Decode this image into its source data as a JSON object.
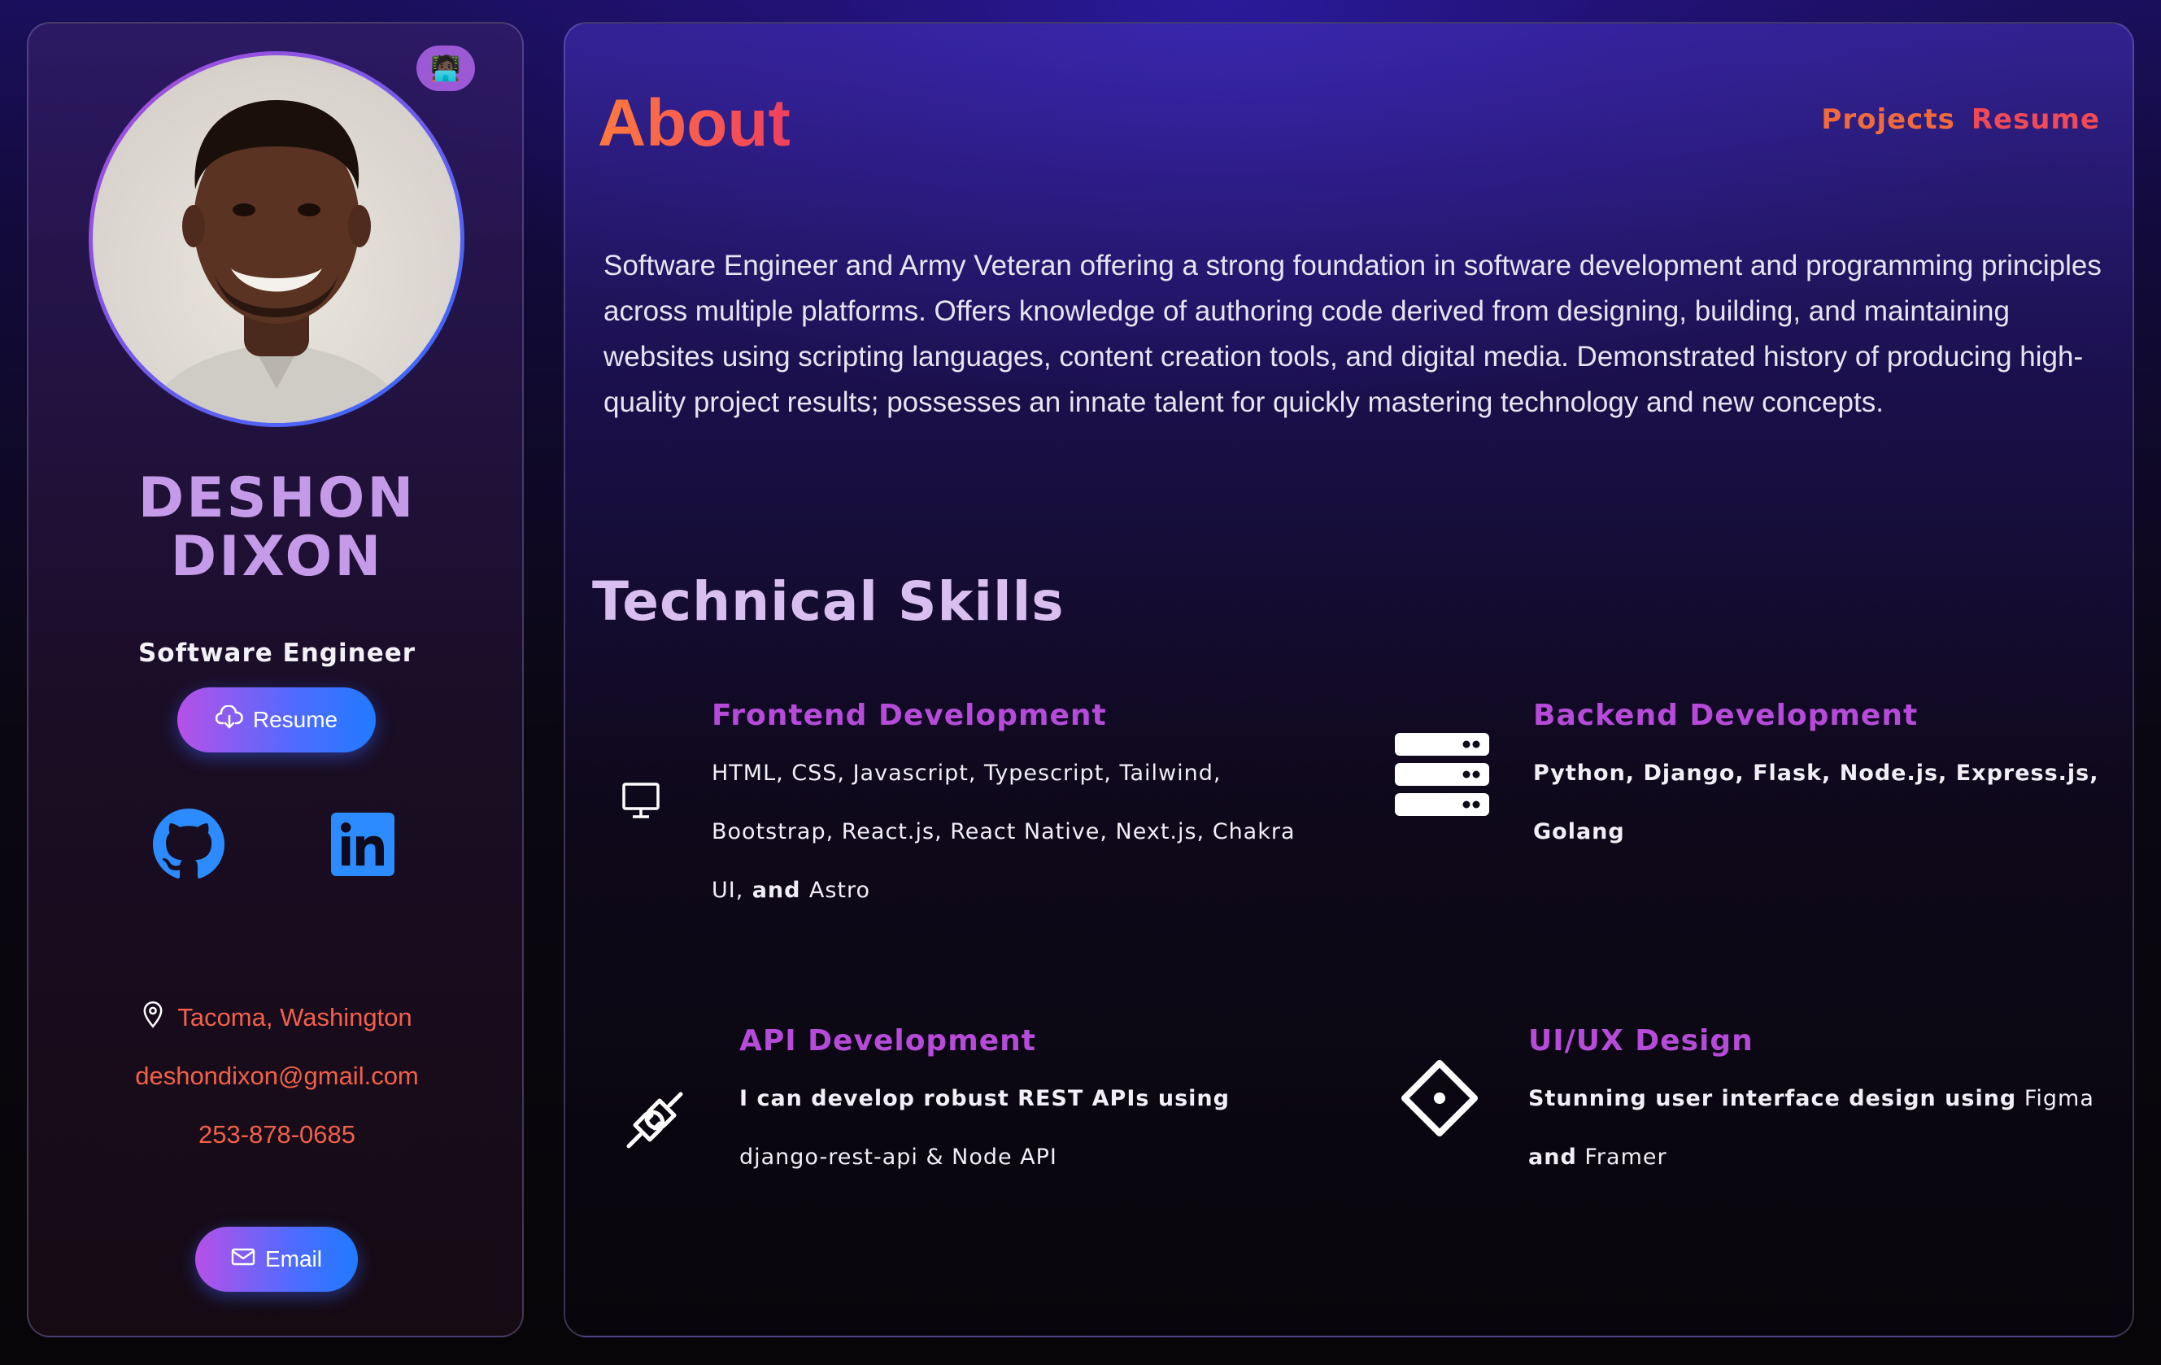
{
  "profile": {
    "name_line1": "DESHON",
    "name_line2": "DIXON",
    "role": "Software Engineer",
    "badge_emoji": "🧑🏿‍💻",
    "resume_label": "Resume",
    "email_button_label": "Email",
    "location": "Tacoma, Washington",
    "email": "deshondixon@gmail.com",
    "phone": "253-878-0685"
  },
  "social": {
    "github_icon": "github-icon",
    "linkedin_icon": "linkedin-icon"
  },
  "header": {
    "title": "About",
    "nav": [
      "Projects",
      "Resume"
    ]
  },
  "about": {
    "text": "Software Engineer and Army Veteran offering a strong foundation in software development and programming principles across multiple platforms. Offers knowledge of authoring code derived from designing, building, and maintaining websites using scripting languages, content creation tools, and digital media. Demonstrated history of producing high-quality project results; possesses an innate talent for quickly mastering technology and new concepts."
  },
  "skills": {
    "title": "Technical Skills",
    "frontend": {
      "title": "Frontend Development",
      "text_a": "HTML, CSS, Javascript, Typescript, Tailwind, Bootstrap, React.js, React Native, Next.js, Chakra UI,",
      "text_b": " and ",
      "text_c": "Astro",
      "icon": "monitor-icon"
    },
    "backend": {
      "title": "Backend Development",
      "text": "Python, Django, Flask, Node.js, Express.js, Golang",
      "icon": "server-icon"
    },
    "api": {
      "title": "API Development",
      "text_a": "I can develop robust REST APIs using",
      "text_b": " django-rest-api & Node API",
      "icon": "plug-icon"
    },
    "uiux": {
      "title": "UI/UX Design",
      "text_a": "Stunning user interface design using",
      "text_b": " Figma ",
      "text_c": "and",
      "text_d": " Framer",
      "icon": "design-icon"
    }
  },
  "colors": {
    "accent_orange": "#f06a3d",
    "accent_purple": "#b54bd8",
    "button_blue": "#1f7bff"
  }
}
